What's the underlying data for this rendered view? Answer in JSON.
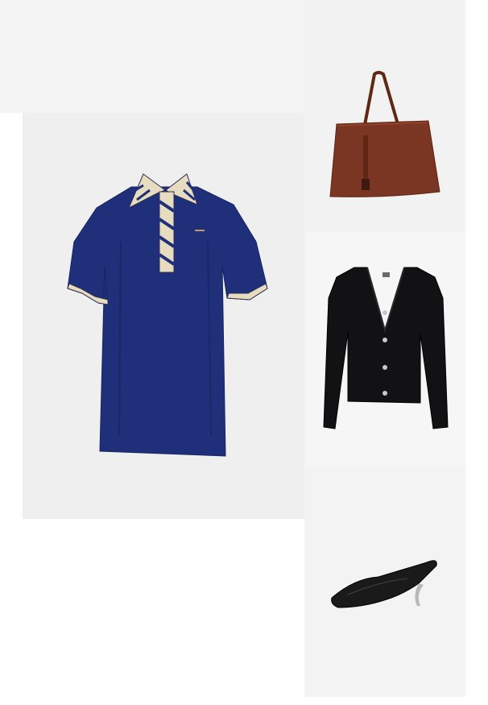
{
  "products": [
    {
      "item": "dress",
      "icon": "dress-icon"
    },
    {
      "item": "tote-bag",
      "icon": "bag-icon"
    },
    {
      "item": "cardigan",
      "icon": "cardigan-icon"
    },
    {
      "item": "mule-shoe",
      "icon": "shoe-icon"
    }
  ],
  "colors": {
    "dress": "#1f2f7a",
    "bag": "#7a3622",
    "cardigan": "#121215",
    "shoe": "#1a1a1a",
    "background": "#f2f2f2"
  }
}
